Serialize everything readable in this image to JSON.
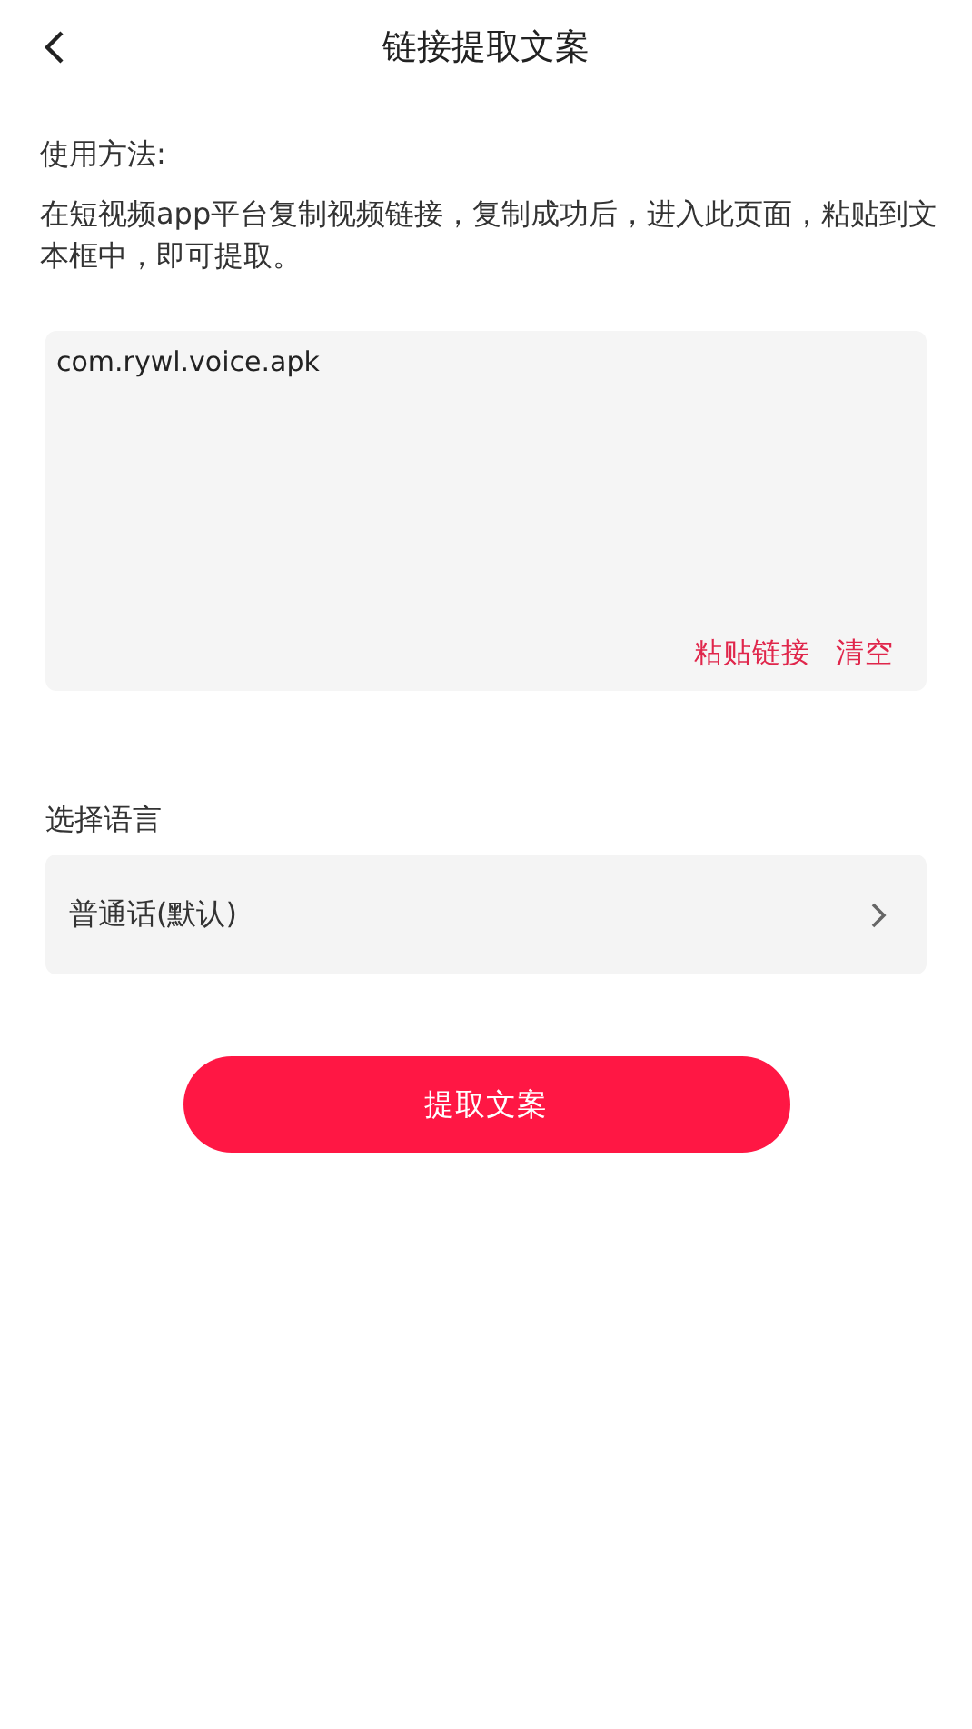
{
  "header": {
    "title": "链接提取文案"
  },
  "usage": {
    "heading": "使用方法:",
    "text": "在短视频app平台复制视频链接，复制成功后，进入此页面，粘贴到文本框中，即可提取。"
  },
  "input": {
    "value": "com.rywl.voice.apk",
    "actions": [
      {
        "label": "粘贴链接"
      },
      {
        "label": "清空"
      }
    ]
  },
  "language": {
    "label": "选择语言",
    "value": "普通话(默认)"
  },
  "submit": {
    "label": "提取文案"
  }
}
